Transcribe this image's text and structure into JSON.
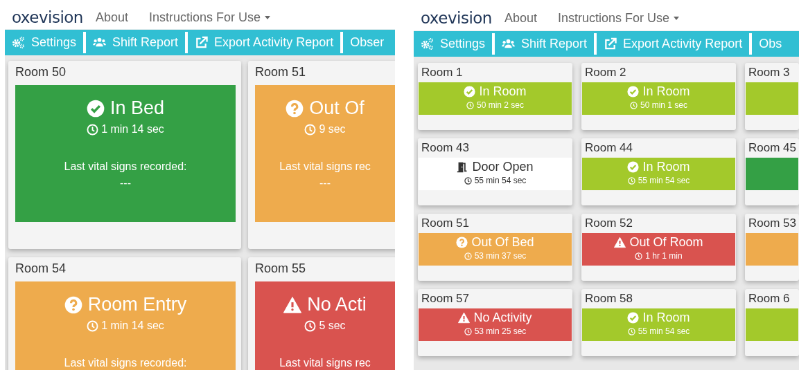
{
  "panels": [
    {
      "nav": {
        "logo": "oxevision",
        "links": [
          {
            "label": "About",
            "dropdown": false
          },
          {
            "label": "Instructions For Use",
            "dropdown": true
          }
        ]
      },
      "toolbar": [
        {
          "label": "Settings"
        },
        {
          "label": "Shift Report"
        },
        {
          "label": "Export Activity Report"
        },
        {
          "label": "Obser"
        }
      ],
      "rooms": [
        {
          "name": "Room 50",
          "status": {
            "kind": "in_bed",
            "label": "In Bed",
            "time": "1 min 14 sec"
          },
          "vitals": {
            "label": "Last vital signs recorded:",
            "value": "---"
          }
        },
        {
          "name": "Room 51",
          "status": {
            "kind": "caution",
            "label": "Out Of",
            "time": "9 sec"
          },
          "vitals": {
            "label": "Last vital signs rec",
            "value": "---"
          }
        },
        {
          "name": "Room 54",
          "status": {
            "kind": "caution",
            "label": "Room Entry",
            "time": "1 min 14 sec"
          },
          "vitals": {
            "label": "Last vital signs recorded:"
          }
        },
        {
          "name": "Room 55",
          "status": {
            "kind": "alert",
            "label": "No Acti",
            "time": "5 sec"
          },
          "vitals": {
            "label": "Last vital signs rec"
          }
        }
      ]
    },
    {
      "nav": {
        "logo": "oxevision",
        "links": [
          {
            "label": "About",
            "dropdown": false
          },
          {
            "label": "Instructions For Use",
            "dropdown": true
          }
        ]
      },
      "toolbar": [
        {
          "label": "Settings"
        },
        {
          "label": "Shift Report"
        },
        {
          "label": "Export Activity Report"
        },
        {
          "label": "Obs"
        }
      ],
      "rooms": [
        {
          "name": "Room 1",
          "status": {
            "kind": "in_room",
            "label": "In Room",
            "time": "50 min 2 sec"
          }
        },
        {
          "name": "Room 2",
          "status": {
            "kind": "in_room",
            "label": "In Room",
            "time": "50 min 1 sec"
          }
        },
        {
          "name": "Room 3",
          "status": {
            "kind": "in_room"
          }
        },
        {
          "name": "Room 43",
          "status": {
            "kind": "door",
            "label": "Door Open",
            "time": "55 min 54 sec"
          }
        },
        {
          "name": "Room 44",
          "status": {
            "kind": "in_room",
            "label": "In Room",
            "time": "55 min 54 sec"
          }
        },
        {
          "name": "Room 45",
          "status": {
            "kind": "in_bed"
          }
        },
        {
          "name": "Room 51",
          "status": {
            "kind": "caution",
            "label": "Out Of Bed",
            "time": "53 min 37 sec"
          }
        },
        {
          "name": "Room 52",
          "status": {
            "kind": "alert",
            "label": "Out Of Room",
            "time": "1 hr 1 min"
          }
        },
        {
          "name": "Room 53",
          "status": {
            "kind": "caution"
          }
        },
        {
          "name": "Room 57",
          "status": {
            "kind": "alert",
            "label": "No Activity",
            "time": "53 min 25 sec"
          }
        },
        {
          "name": "Room 58",
          "status": {
            "kind": "in_room",
            "label": "In Room",
            "time": "55 min 54 sec"
          }
        },
        {
          "name": "Room 6",
          "status": {
            "kind": "in_room"
          }
        }
      ]
    }
  ]
}
